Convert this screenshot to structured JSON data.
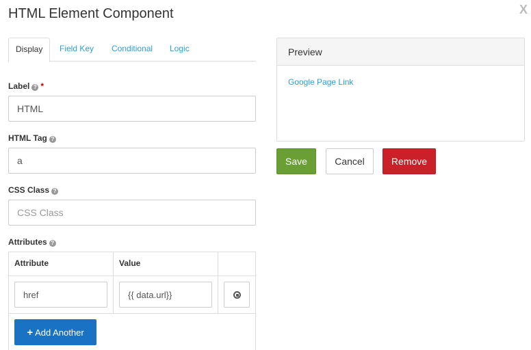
{
  "dialog": {
    "title": "HTML Element Component",
    "close_label": "X"
  },
  "tabs": [
    {
      "label": "Display",
      "active": true
    },
    {
      "label": "Field Key",
      "active": false
    },
    {
      "label": "Conditional",
      "active": false
    },
    {
      "label": "Logic",
      "active": false
    }
  ],
  "form": {
    "label_field": {
      "label": "Label",
      "required_mark": "*",
      "value": "HTML"
    },
    "tag_field": {
      "label": "HTML Tag",
      "value": "a"
    },
    "css_field": {
      "label": "CSS Class",
      "value": "",
      "placeholder": "CSS Class"
    },
    "attributes": {
      "label": "Attributes",
      "columns": [
        "Attribute",
        "Value"
      ],
      "rows": [
        {
          "attribute": "href",
          "value": "{{ data.url}}"
        }
      ],
      "add_label": "Add Another",
      "add_icon": "plus-icon",
      "remove_icon": "remove-circle-icon"
    },
    "help_icon": "question-circle-icon"
  },
  "preview": {
    "heading": "Preview",
    "link_text": "Google Page Link"
  },
  "actions": {
    "save": "Save",
    "cancel": "Cancel",
    "remove": "Remove"
  },
  "colors": {
    "link": "#2a9fd6",
    "save": "#6a9f35",
    "remove": "#c9202a",
    "primary": "#1a72c4"
  }
}
